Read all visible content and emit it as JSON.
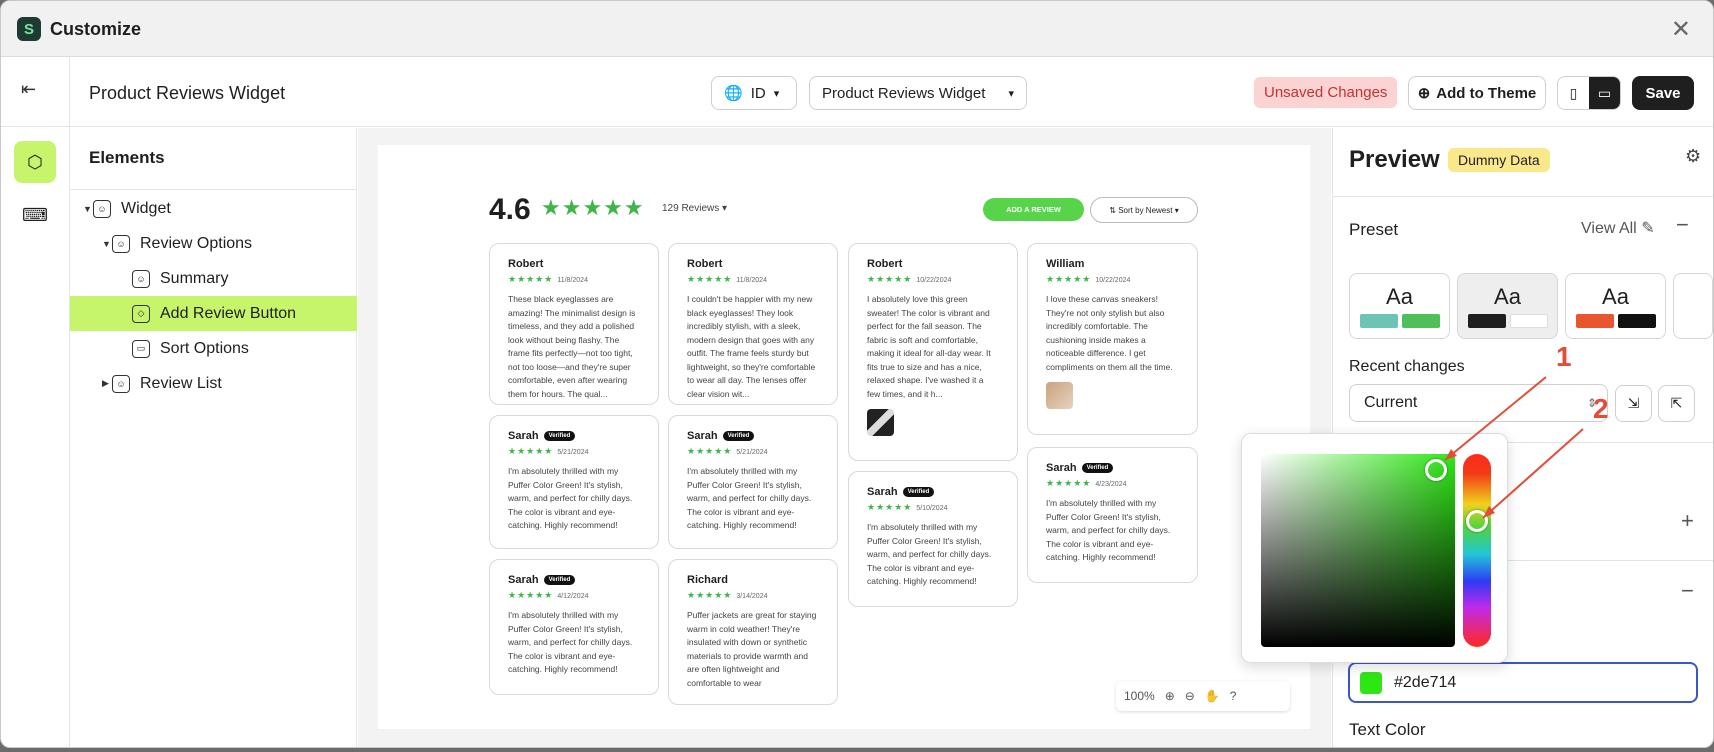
{
  "window": {
    "title": "Customize"
  },
  "topbar": {
    "page_name": "Product Reviews Widget",
    "language": "ID",
    "page_select": "Product Reviews Widget",
    "unsaved": "Unsaved Changes",
    "add_to_theme": "Add to Theme",
    "save": "Save"
  },
  "elements": {
    "header": "Elements",
    "items": [
      {
        "label": "Widget"
      },
      {
        "label": "Review Options"
      },
      {
        "label": "Summary"
      },
      {
        "label": "Add Review Button"
      },
      {
        "label": "Sort Options"
      },
      {
        "label": "Review List"
      }
    ]
  },
  "widget": {
    "rating": "4.6",
    "reviews_count": "129 Reviews",
    "add_review": "ADD A REVIEW",
    "sort": "Sort by Newest",
    "reviews": [
      {
        "name": "Robert",
        "date": "11/8/2024",
        "text": "These black eyeglasses are amazing! The minimalist design is timeless, and they add a polished look without being flashy. The frame fits perfectly—not too tight, not too loose—and they're super comfortable, even after wearing them for hours. The qual..."
      },
      {
        "name": "Robert",
        "date": "11/8/2024",
        "text": "I couldn't be happier with my new black eyeglasses! They look incredibly stylish, with a sleek, modern design that goes with any outfit. The frame feels sturdy but lightweight, so they're comfortable to wear all day. The lenses offer clear vision wit..."
      },
      {
        "name": "Robert",
        "date": "10/22/2024",
        "text": "I absolutely love this green sweater! The color is vibrant and perfect for the fall season. The fabric is soft and comfortable, making it ideal for all-day wear. It fits true to size and has a nice, relaxed shape. I've washed it a few times, and it h..."
      },
      {
        "name": "William",
        "date": "10/22/2024",
        "text": "I love these canvas sneakers! They're not only stylish but also incredibly comfortable. The cushioning inside makes a noticeable difference. I get compliments on them all the time."
      },
      {
        "name": "Sarah",
        "verified": "Verified",
        "date": "5/21/2024",
        "text": "I'm absolutely thrilled with my Puffer Color Green! It's stylish, warm, and perfect for chilly days. The color is vibrant and eye-catching. Highly recommend!"
      },
      {
        "name": "Sarah",
        "verified": "Verified",
        "date": "5/21/2024",
        "text": "I'm absolutely thrilled with my Puffer Color Green! It's stylish, warm, and perfect for chilly days. The color is vibrant and eye-catching. Highly recommend!"
      },
      {
        "name": "Sarah",
        "verified": "Verified",
        "date": "5/10/2024",
        "text": "I'm absolutely thrilled with my Puffer Color Green! It's stylish, warm, and perfect for chilly days. The color is vibrant and eye-catching. Highly recommend!"
      },
      {
        "name": "Sarah",
        "verified": "Verified",
        "date": "4/23/2024",
        "text": "I'm absolutely thrilled with my Puffer Color Green! It's stylish, warm, and perfect for chilly days. The color is vibrant and eye-catching. Highly recommend!"
      },
      {
        "name": "Sarah",
        "verified": "Verified",
        "date": "4/12/2024",
        "text": "I'm absolutely thrilled with my Puffer Color Green! It's stylish, warm, and perfect for chilly days. The color is vibrant and eye-catching. Highly recommend!"
      },
      {
        "name": "Richard",
        "date": "3/14/2024",
        "text": "Puffer jackets are great for staying warm in cold weather! They're insulated with down or synthetic materials to provide warmth and are often lightweight and comfortable to wear"
      }
    ]
  },
  "zoom": {
    "level": "100%"
  },
  "right_panel": {
    "title": "Preview",
    "badge": "Dummy Data",
    "preset": "Preset",
    "view_all": "View All",
    "preset_cards": [
      {
        "label": "Aa",
        "colors": [
          "#6cc4b4",
          "#4fbf5a"
        ]
      },
      {
        "label": "Aa",
        "colors": [
          "#1f1f1f",
          "#ffffff"
        ]
      },
      {
        "label": "Aa",
        "colors": [
          "#e8552f",
          "#111111"
        ]
      }
    ],
    "recent_changes": "Recent changes",
    "recent_value": "Current",
    "hex_value": "#2de714",
    "text_color": "Text Color"
  },
  "color_picker": {
    "hex": "#2de714",
    "hue_color": "#2de714"
  },
  "annotations": {
    "one": "1",
    "two": "2"
  },
  "colors": {
    "accent": "#c6f46b",
    "brand_green": "#58d44b",
    "star": "#3fb54a"
  }
}
